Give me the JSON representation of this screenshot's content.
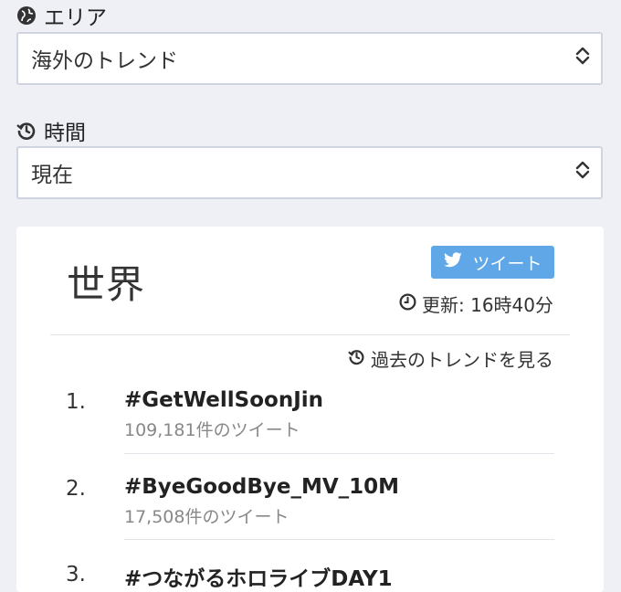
{
  "area": {
    "label": "エリア",
    "selected": "海外のトレンド"
  },
  "time": {
    "label": "時間",
    "selected": "現在"
  },
  "card": {
    "title": "世界",
    "tweet_button": "ツイート",
    "updated_label": "更新: 16時40分",
    "past_trends_link": "過去のトレンドを見る",
    "trends": [
      {
        "rank": "1.",
        "name": "#GetWellSoonJin",
        "count": "109,181件のツイート"
      },
      {
        "rank": "2.",
        "name": "#ByeGoodBye_MV_10M",
        "count": "17,508件のツイート"
      },
      {
        "rank": "3.",
        "name": "#つながるホロライブDAY1",
        "count": ""
      }
    ]
  },
  "icons": {
    "area": "globe-icon",
    "time": "history-icon",
    "tweet": "twitter-bird-icon",
    "updated": "clock-icon",
    "past": "history-icon",
    "select": "chevron-updown-icon"
  },
  "colors": {
    "page_background": "#eef0f5",
    "tweet_button": "#5fa7e6",
    "muted_text": "#888888"
  }
}
